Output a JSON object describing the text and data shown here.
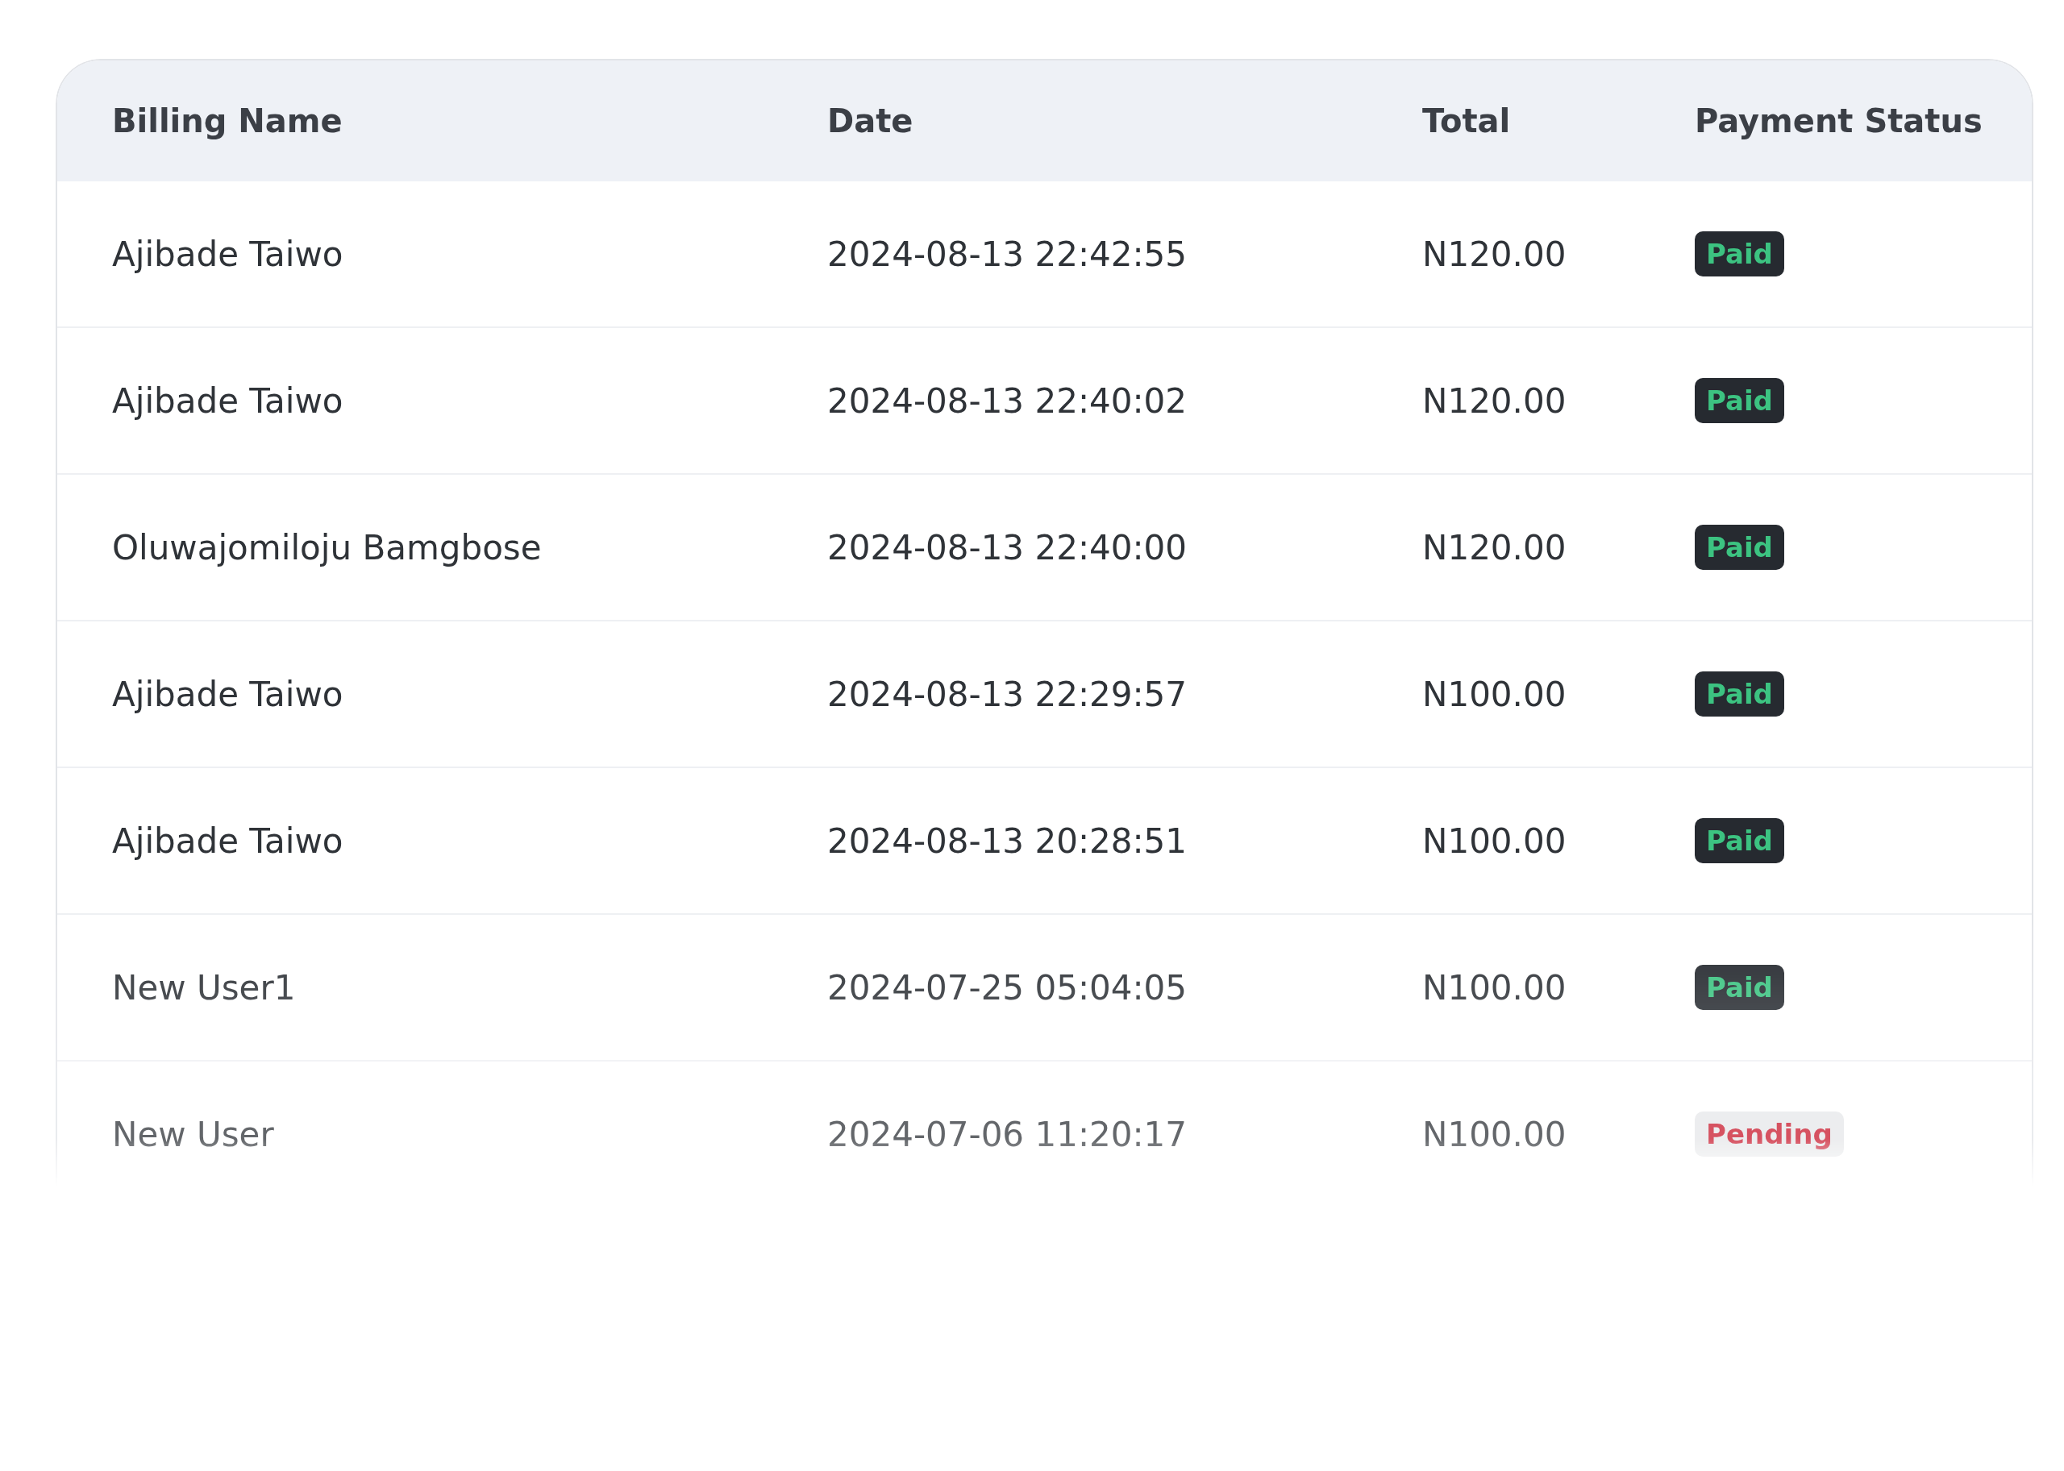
{
  "table": {
    "columns": [
      "Billing Name",
      "Date",
      "Total",
      "Payment Status"
    ],
    "rows": [
      {
        "billing_name": "Ajibade Taiwo",
        "date": "2024-08-13 22:42:55",
        "total": "N120.00",
        "status": {
          "label": "Paid",
          "kind": "paid"
        }
      },
      {
        "billing_name": "Ajibade Taiwo",
        "date": "2024-08-13 22:40:02",
        "total": "N120.00",
        "status": {
          "label": "Paid",
          "kind": "paid"
        }
      },
      {
        "billing_name": "Oluwajomiloju Bamgbose",
        "date": "2024-08-13 22:40:00",
        "total": "N120.00",
        "status": {
          "label": "Paid",
          "kind": "paid"
        }
      },
      {
        "billing_name": "Ajibade Taiwo",
        "date": "2024-08-13 22:29:57",
        "total": "N100.00",
        "status": {
          "label": "Paid",
          "kind": "paid"
        }
      },
      {
        "billing_name": "Ajibade Taiwo",
        "date": "2024-08-13 20:28:51",
        "total": "N100.00",
        "status": {
          "label": "Paid",
          "kind": "paid"
        }
      },
      {
        "billing_name": "New User1",
        "date": "2024-07-25 05:04:05",
        "total": "N100.00",
        "status": {
          "label": "Paid",
          "kind": "paid"
        }
      },
      {
        "billing_name": "New User",
        "date": "2024-07-06 11:20:17",
        "total": "N100.00",
        "status": {
          "label": "Pending",
          "kind": "pending"
        }
      }
    ]
  }
}
